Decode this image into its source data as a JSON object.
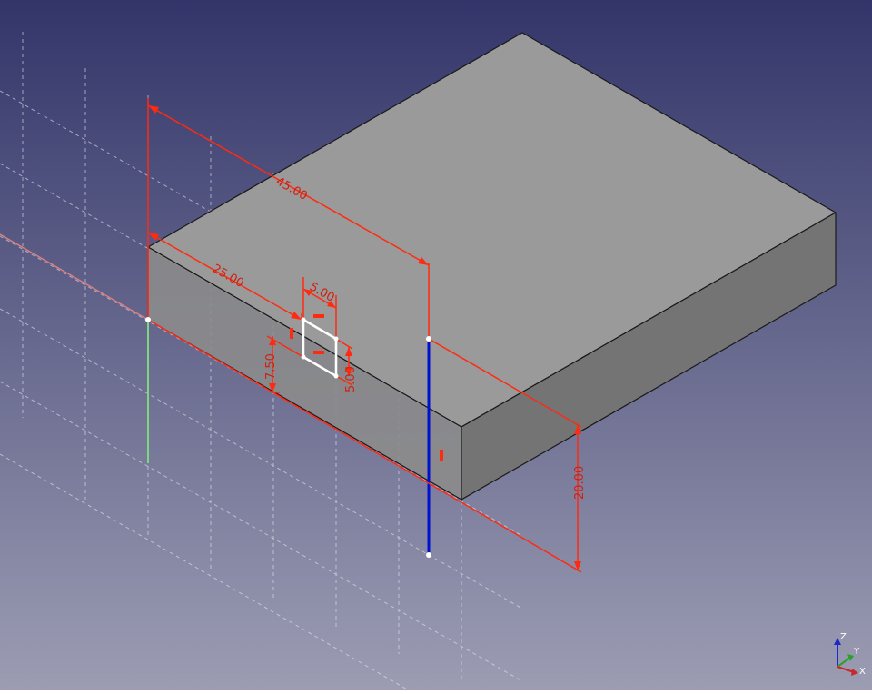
{
  "viewport": {
    "background_top": "#33356a",
    "background_bottom": "#9c9db3"
  },
  "colors": {
    "constraint": "#ff2a10",
    "dimension_text": "#d02010",
    "grid": "#e6e6ee",
    "x_axis": "#d88080",
    "y_axis": "#7ed67e",
    "z_axis": "#0010d0",
    "sketch_geometry": "#ffffff",
    "solid_top": "#9a9a9a",
    "solid_front": "#8c8c8c",
    "solid_side": "#747474",
    "edge": "#1a1a1a"
  },
  "dimensions": {
    "length_45": "45.00",
    "offset_25": "25.00",
    "width_5": "5.00",
    "height_5": "5.00",
    "height_7_5": "7.50",
    "height_20": "20.00"
  },
  "axis_cross": {
    "z_label": "Z",
    "y_label": "Y",
    "x_label": "X"
  }
}
